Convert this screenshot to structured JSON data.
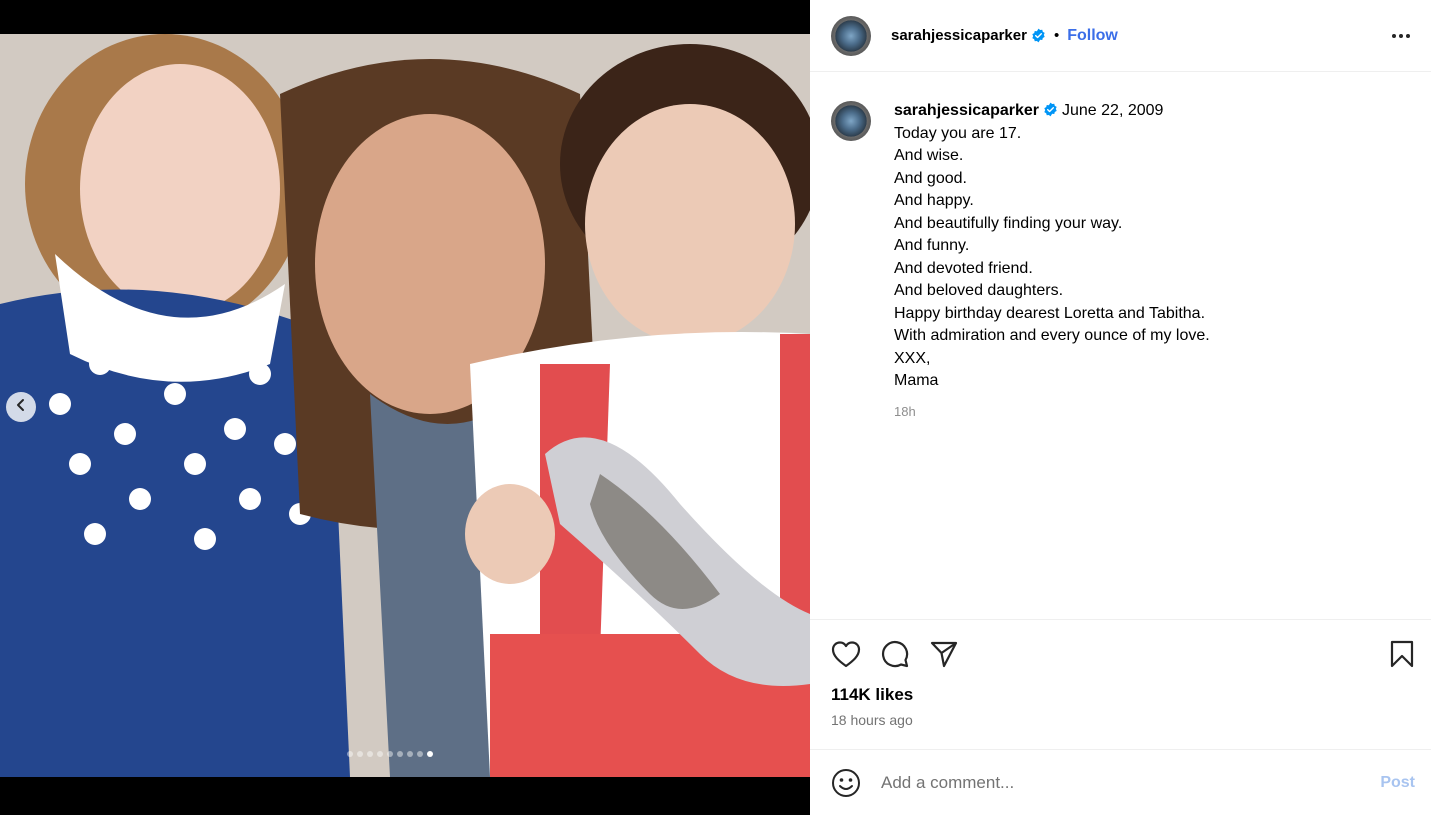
{
  "post": {
    "username": "sarahjessicaparker",
    "follow_label": "Follow",
    "separator": "•",
    "avatar_icon": "profile-avatar-icon",
    "verified_color": "#0095f6",
    "accent_color": "#3b6ee8"
  },
  "caption": {
    "username": "sarahjessicaparker",
    "date": "June 22, 2009",
    "lines": [
      "Today you are 17.",
      "And wise.",
      "And good.",
      "And happy.",
      "And beautifully finding your way.",
      "And funny.",
      "And devoted friend.",
      "And beloved daughters.",
      "Happy birthday dearest Loretta and Tabitha.",
      "With admiration and every ounce of my love.",
      "XXX,",
      "Mama"
    ],
    "time_ago": "18h"
  },
  "media": {
    "carousel_total": 9,
    "carousel_active_index": 9
  },
  "actions": {
    "likes": "114K likes",
    "posted_ago": "18 hours ago"
  },
  "comment": {
    "placeholder": "Add a comment...",
    "post_label": "Post"
  }
}
